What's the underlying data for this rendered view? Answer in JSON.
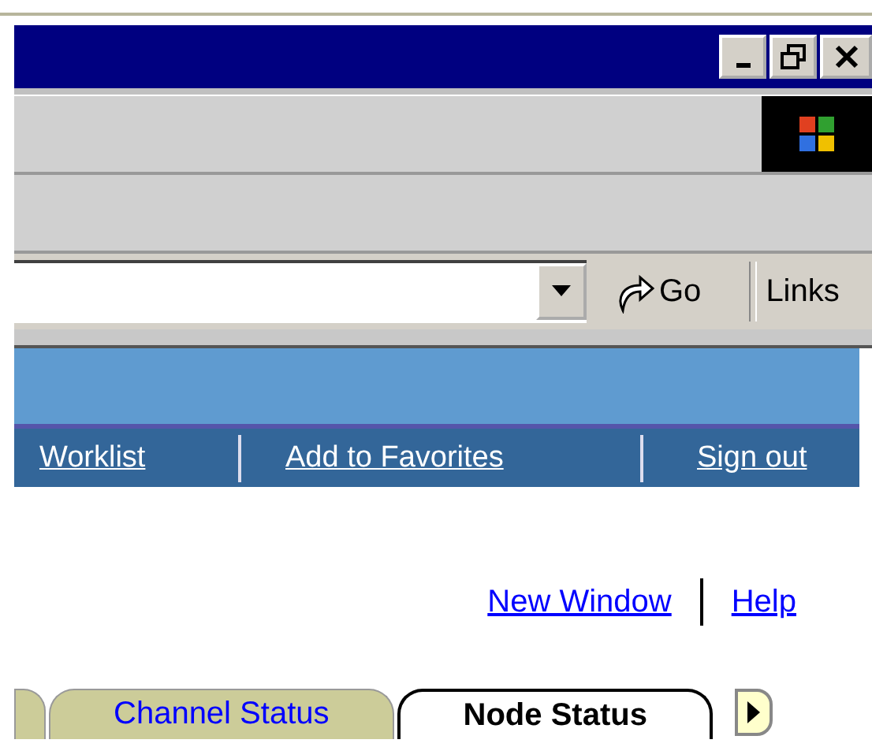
{
  "address_bar": {
    "go_label": "Go",
    "links_label": "Links"
  },
  "nav_links": [
    "Worklist",
    "Add to Favorites",
    "Sign out"
  ],
  "utility_links": [
    "New Window",
    "Help"
  ],
  "tabs": [
    {
      "label": "Channel Status",
      "selected": false
    },
    {
      "label": "Node Status",
      "selected": true
    }
  ]
}
